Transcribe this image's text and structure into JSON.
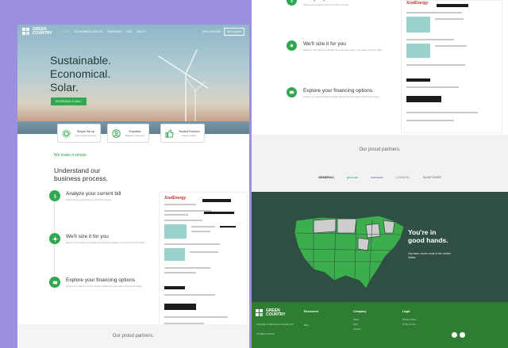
{
  "brand": {
    "name_line1": "GREEN",
    "name_line2": "COUNTRY",
    "accent": "#2fa84f",
    "dark": "#2f4f43",
    "footer_green": "#2f7d32"
  },
  "nav": {
    "items": [
      "HOME",
      "ECONOMICAL SOLAR",
      "FINANCING",
      "FAQ",
      "ABOUT"
    ],
    "phone": "(800) 449-9190",
    "quote_button": "Get a Quote"
  },
  "hero": {
    "line1": "Sustainable.",
    "line2": "Economical.",
    "line3": "Solar.",
    "cta": "SCHEDULE A CALL"
  },
  "features": [
    {
      "title": "Simple Set up",
      "sub": "Fast, hassle-free setup",
      "icon": "gear-icon"
    },
    {
      "title": "Expertise",
      "sub": "Backed by solar pros",
      "icon": "person-icon"
    },
    {
      "title": "Trusted Partners",
      "sub": "Industry leaders",
      "icon": "thumbs-up-icon"
    }
  ],
  "process": {
    "eyebrow": "We make it simple.",
    "heading_line1": "Understand our",
    "heading_line2": "business process.",
    "steps": [
      {
        "title": "Analyze your current bill",
        "desc": "Review energy consumption on the bill in minutes.",
        "icon": "dollar-icon"
      },
      {
        "title": "We'll size it for you",
        "desc": "Based on your usage we calculate the exact panel system you need so the bill is offset.",
        "icon": "sun-icon"
      },
      {
        "title": "Explore your financing options",
        "desc": "Finance your system through a simple, flexible loan with options that fit your budget.",
        "icon": "card-icon"
      }
    ],
    "bill_brand": "XcelEnergy"
  },
  "partners": {
    "heading": "Our proud partners.",
    "logos": [
      "GENERAC",
      "generac",
      "sunnova",
      "LOANPAL",
      "SUNPOWER"
    ]
  },
  "coverage": {
    "heading_line1": "You're in",
    "heading_line2": "good hands.",
    "text": "Our team covers most of the United States"
  },
  "footer": {
    "copyright": "Copyright © 2021 Green Country LLC",
    "rights": "All rights reserved",
    "columns": [
      {
        "title": "Resources",
        "items": [
          "Blog"
        ]
      },
      {
        "title": "Company",
        "items": [
          "About",
          "FAQ",
          "Contact"
        ]
      },
      {
        "title": "Legal",
        "items": [
          "Privacy Policy",
          "Terms of Use"
        ]
      }
    ]
  }
}
